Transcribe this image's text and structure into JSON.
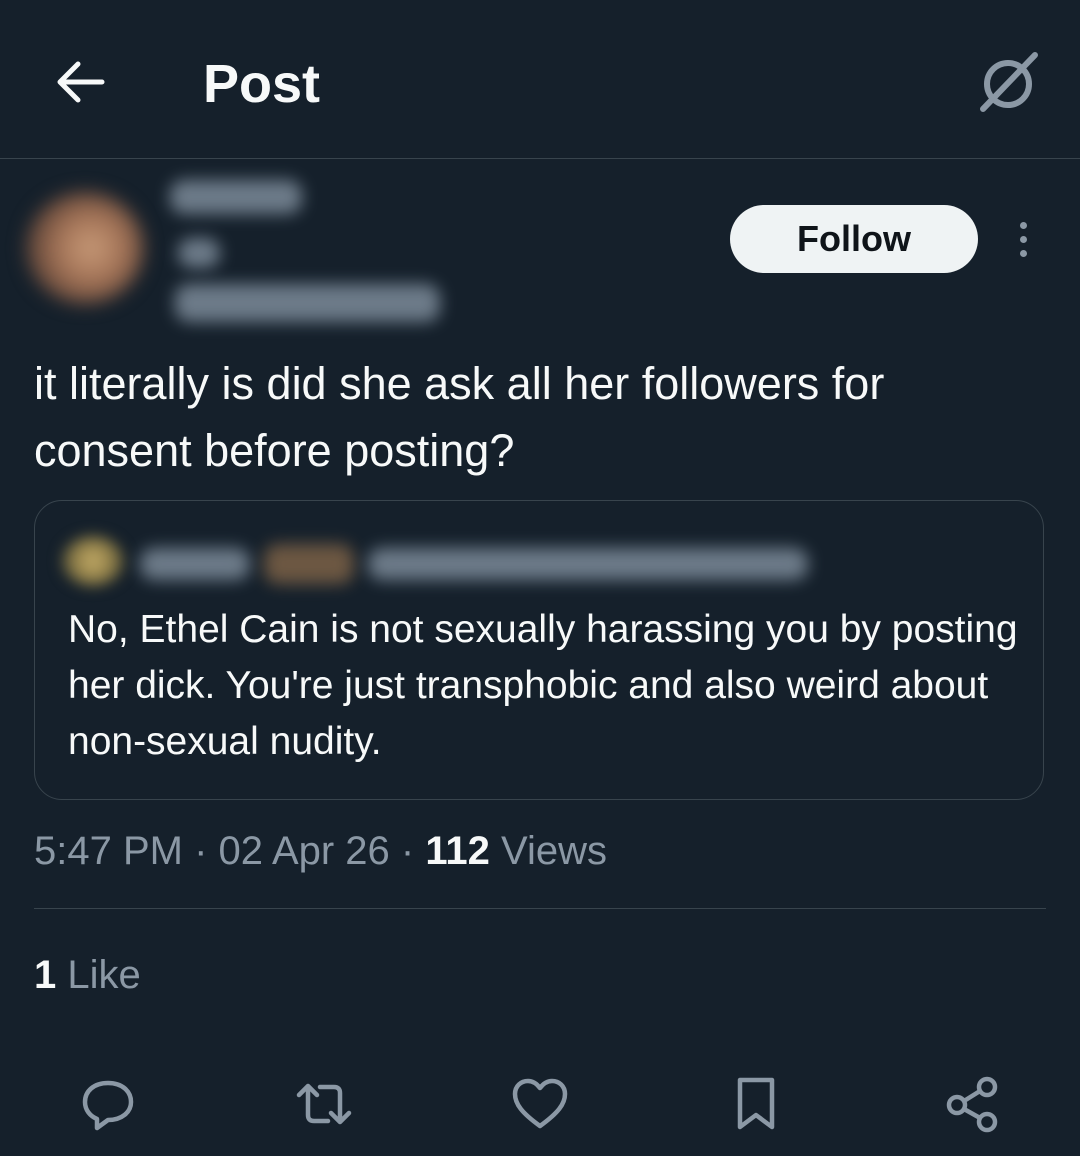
{
  "header": {
    "title": "Post",
    "back_icon": "arrow-left-icon",
    "grok_icon": "grok-icon"
  },
  "author": {
    "follow_label": "Follow",
    "more_icon": "more-vertical-icon"
  },
  "post": {
    "text": "it literally is did she ask all her followers for consent before posting?"
  },
  "quote": {
    "text": "No, Ethel Cain is not sexually harassing you by posting her dick. You're just transphobic and also weird about non-sexual nudity."
  },
  "meta": {
    "time": "5:47 PM",
    "separator": "·",
    "date": "02 Apr 26",
    "views_count": "112",
    "views_label": "Views"
  },
  "stats": {
    "likes_count": "1",
    "likes_label": "Like"
  },
  "actions": [
    "reply-icon",
    "repost-icon",
    "like-icon",
    "bookmark-icon",
    "share-icon"
  ],
  "colors": {
    "background": "#15202b",
    "text_primary": "#f7f9f9",
    "text_secondary": "#8b98a5",
    "border": "#38444d",
    "follow_bg": "#eff3f4"
  }
}
